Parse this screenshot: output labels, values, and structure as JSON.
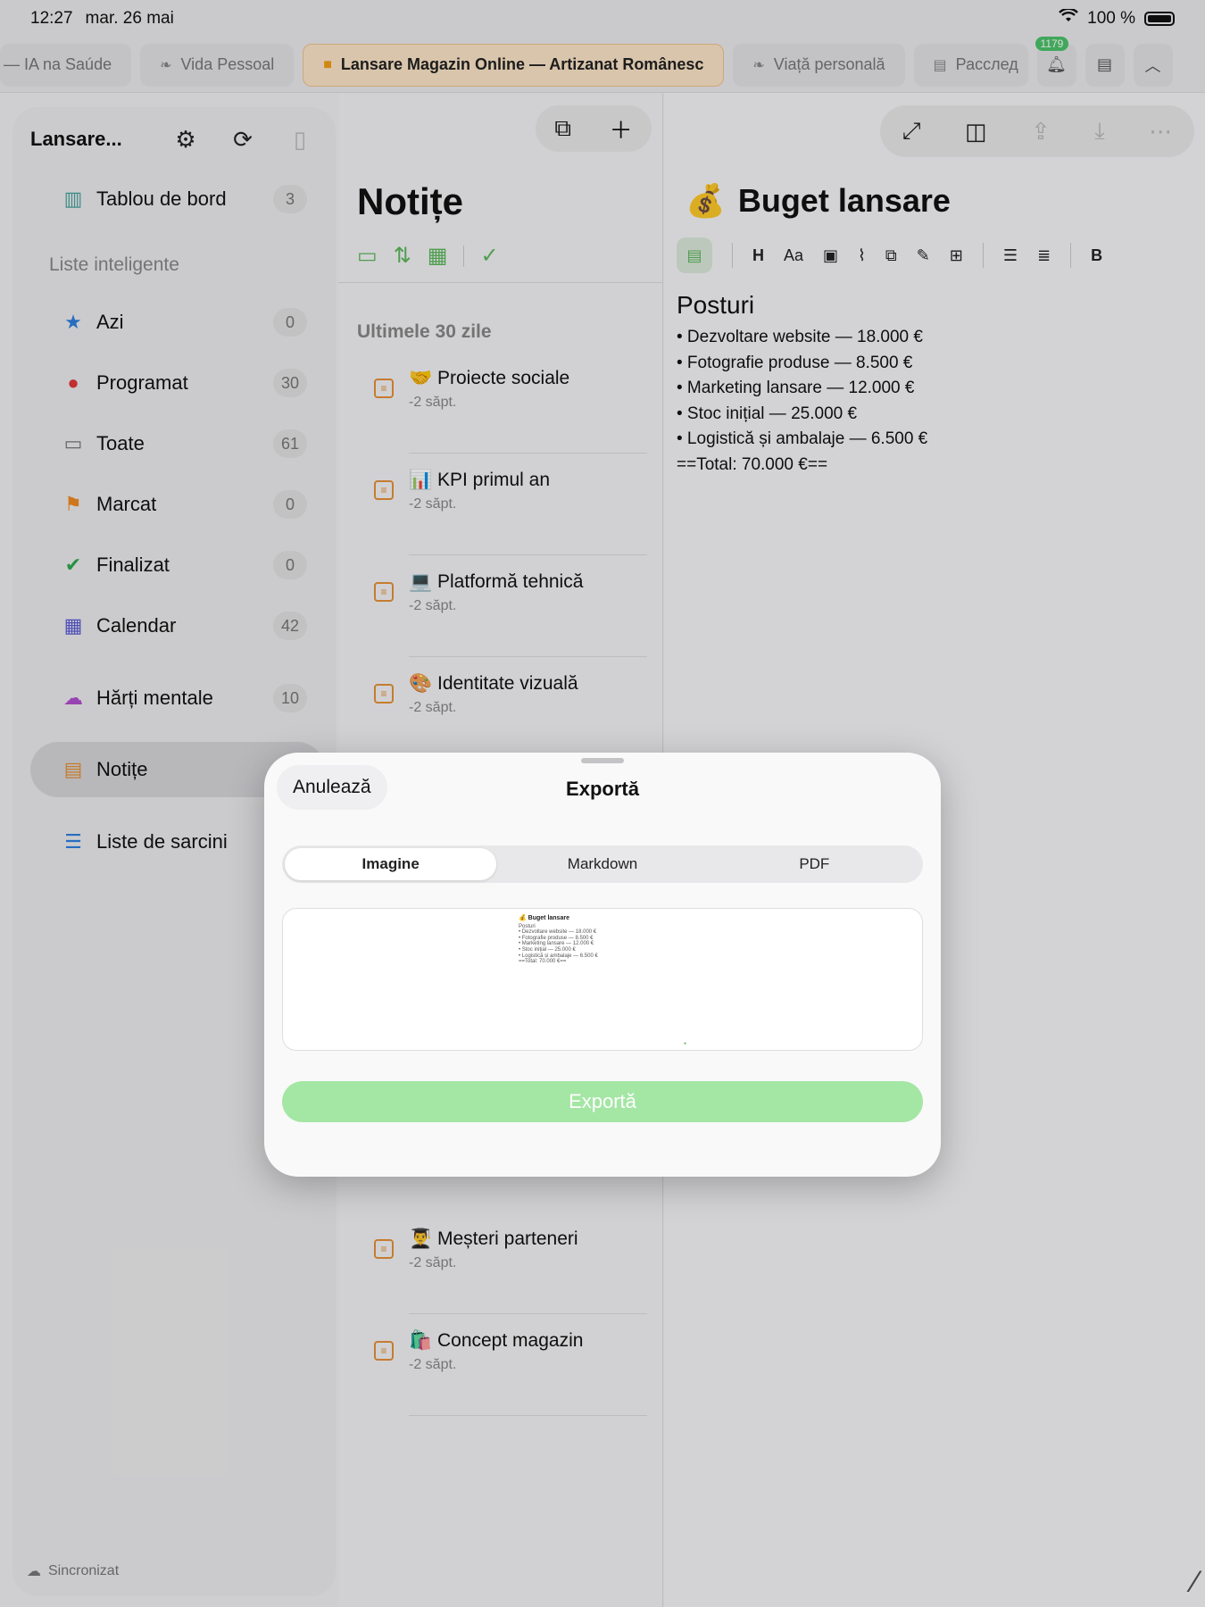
{
  "status_bar": {
    "time": "12:27",
    "date": "mar. 26 mai",
    "battery": "100 %"
  },
  "tabs": [
    {
      "label": "— IA na Saúde",
      "icon": "note-icon",
      "active": false
    },
    {
      "label": "Vida Pessoal",
      "icon": "leaf-icon",
      "active": false
    },
    {
      "label": "Lansare Magazin Online — Artizanat Românesc",
      "icon": "bag-icon",
      "active": true
    },
    {
      "label": "Viață personală",
      "icon": "leaf-icon",
      "active": false
    },
    {
      "label": "Расслед",
      "icon": "doc-search-icon",
      "active": false
    }
  ],
  "tab_actions": {
    "notifications_count": "1179"
  },
  "sidebar": {
    "title": "Lansare...",
    "section_label": "Liste inteligente",
    "items": [
      {
        "label": "Tablou de bord",
        "count": "3",
        "icon": "dashboard-icon"
      },
      {
        "label": "Azi",
        "count": "0",
        "icon": "star-icon"
      },
      {
        "label": "Programat",
        "count": "30",
        "icon": "calendar-clock-icon"
      },
      {
        "label": "Toate",
        "count": "61",
        "icon": "inbox-icon"
      },
      {
        "label": "Marcat",
        "count": "0",
        "icon": "flag-icon"
      },
      {
        "label": "Finalizat",
        "count": "0",
        "icon": "check-circle-icon"
      },
      {
        "label": "Calendar",
        "count": "42",
        "icon": "calendar-icon"
      },
      {
        "label": "Hărți mentale",
        "count": "10",
        "icon": "brain-icon"
      },
      {
        "label": "Notițe",
        "count": "",
        "icon": "note-icon"
      },
      {
        "label": "Liste de sarcini",
        "count": "",
        "icon": "checklist-icon"
      }
    ],
    "footer": "Sincronizat"
  },
  "notes_pane": {
    "title": "Notițe",
    "section": "Ultimele 30 zile",
    "notes": [
      {
        "title": "🤝 Proiecte sociale",
        "date": "-2 săpt."
      },
      {
        "title": "📊 KPI primul an",
        "date": "-2 săpt."
      },
      {
        "title": "💻 Platformă tehnică",
        "date": "-2 săpt."
      },
      {
        "title": "🎨 Identitate vizuală",
        "date": "-2 săpt."
      },
      {
        "title": "👨‍🎓 Meșteri parteneri",
        "date": "-2 săpt."
      },
      {
        "title": "🛍️ Concept magazin",
        "date": "-2 săpt."
      }
    ]
  },
  "editor": {
    "emoji": "💰",
    "title": "Buget lansare",
    "heading": "Posturi",
    "lines": [
      "• Dezvoltare website — 18.000 €",
      "• Fotografie produse — 8.500 €",
      "• Marketing lansare — 12.000 €",
      "• Stoc inițial — 25.000 €",
      "• Logistică și ambalaje — 6.500 €",
      "==Total: 70.000 €=="
    ],
    "format_buttons": [
      "H",
      "Aa",
      "B"
    ]
  },
  "export_sheet": {
    "cancel": "Anulează",
    "title": "Exportă",
    "options": [
      "Imagine",
      "Markdown",
      "PDF"
    ],
    "selected": "Imagine",
    "export_button": "Exportă"
  },
  "colors": {
    "accent_green": "#5cb85c",
    "active_tab": "#fde6c8",
    "note_orange": "#e69138"
  }
}
